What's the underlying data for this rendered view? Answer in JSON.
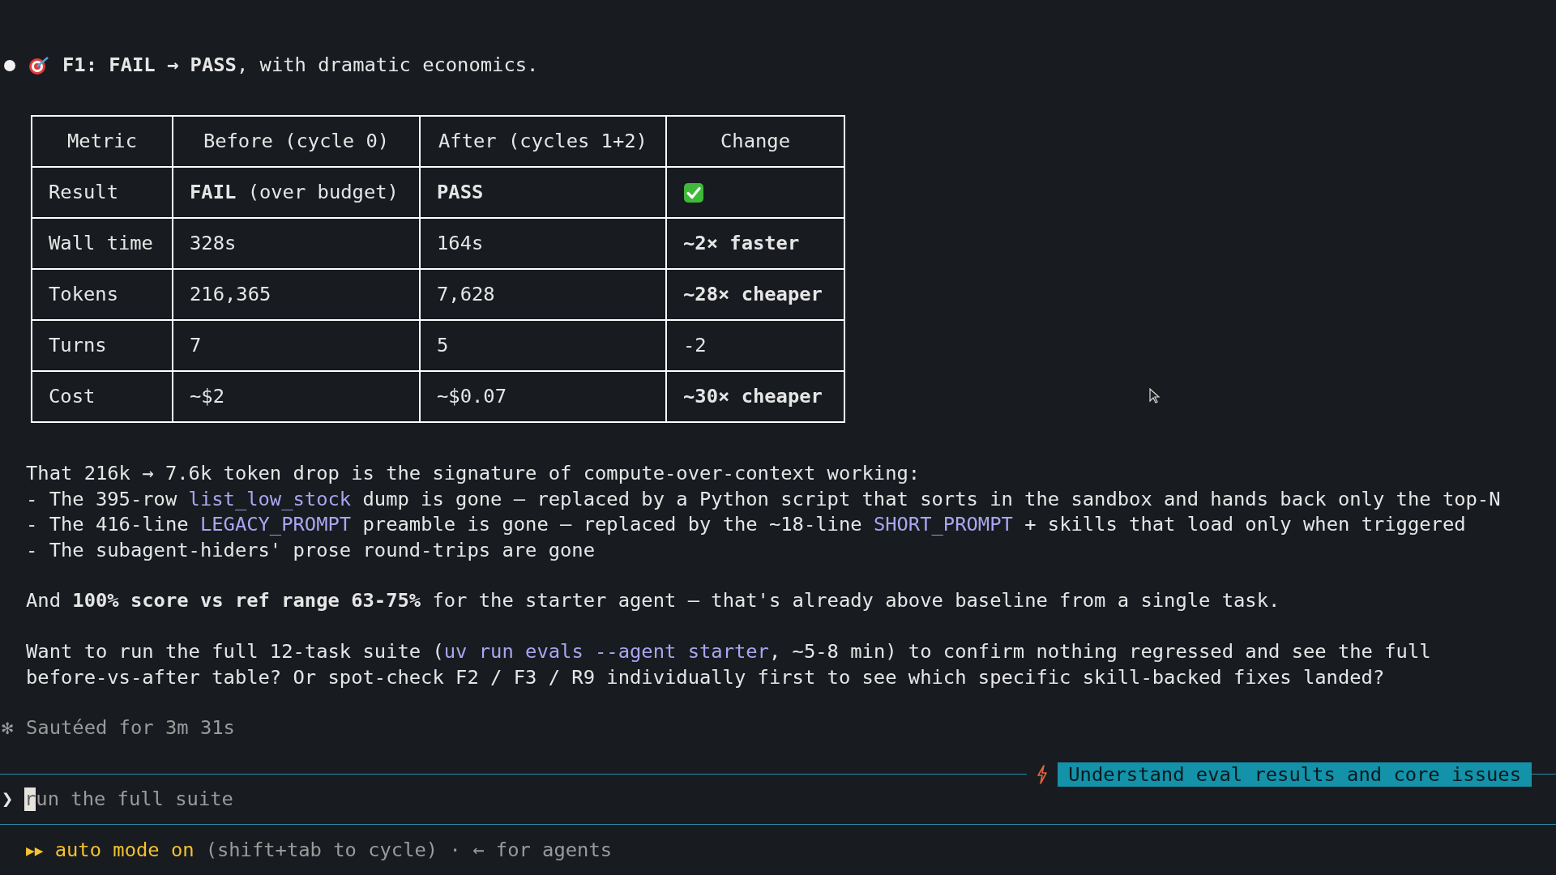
{
  "message": {
    "title": "**F1: FAIL → PASS**, with dramatic economics."
  },
  "table": {
    "columns": [
      "Metric",
      "Before (cycle 0)",
      "After (cycles 1+2)",
      "Change"
    ],
    "rows": [
      [
        {
          "kind": "text",
          "text": "Result",
          "bold": false
        },
        {
          "kind": "text",
          "text": "**FAIL** (over budget)",
          "bold": false
        },
        {
          "kind": "text",
          "text": "PASS",
          "bold": true
        },
        {
          "kind": "check"
        }
      ],
      [
        {
          "kind": "text",
          "text": "Wall time",
          "bold": false
        },
        {
          "kind": "text",
          "text": "328s",
          "bold": false
        },
        {
          "kind": "text",
          "text": "164s",
          "bold": false
        },
        {
          "kind": "text",
          "text": "~2× faster",
          "bold": true
        }
      ],
      [
        {
          "kind": "text",
          "text": "Tokens",
          "bold": false
        },
        {
          "kind": "text",
          "text": "216,365",
          "bold": false
        },
        {
          "kind": "text",
          "text": "7,628",
          "bold": false
        },
        {
          "kind": "text",
          "text": "~28× cheaper",
          "bold": true
        }
      ],
      [
        {
          "kind": "text",
          "text": "Turns",
          "bold": false
        },
        {
          "kind": "text",
          "text": "7",
          "bold": false
        },
        {
          "kind": "text",
          "text": "5",
          "bold": false
        },
        {
          "kind": "text",
          "text": "-2",
          "bold": false
        }
      ],
      [
        {
          "kind": "text",
          "text": "Cost",
          "bold": false
        },
        {
          "kind": "text",
          "text": "~$2",
          "bold": false
        },
        {
          "kind": "text",
          "text": "~$0.07",
          "bold": false
        },
        {
          "kind": "text",
          "text": "~30× cheaper",
          "bold": true
        }
      ]
    ]
  },
  "paragraphs": [
    [
      [
        {
          "kind": "plain",
          "text": "That 216k → 7.6k token drop is the signature of compute-over-context working:"
        }
      ],
      [
        {
          "kind": "plain",
          "text": "- The 395-row "
        },
        {
          "kind": "code",
          "text": "list_low_stock"
        },
        {
          "kind": "plain",
          "text": " dump is gone — replaced by a Python script that sorts in the sandbox and hands back only the top-N"
        }
      ],
      [
        {
          "kind": "plain",
          "text": "- The 416-line "
        },
        {
          "kind": "code",
          "text": "LEGACY_PROMPT"
        },
        {
          "kind": "plain",
          "text": " preamble is gone — replaced by the ~18-line "
        },
        {
          "kind": "code",
          "text": "SHORT_PROMPT"
        },
        {
          "kind": "plain",
          "text": " + skills that load only when triggered"
        }
      ],
      [
        {
          "kind": "plain",
          "text": "- The subagent-hiders' prose round-trips are gone"
        }
      ]
    ],
    [
      [
        {
          "kind": "plain",
          "text": "And **100% score vs ref range 63-75%** for the starter agent — that's already above baseline from a single task."
        }
      ]
    ],
    [
      [
        {
          "kind": "plain",
          "text": "Want to run the full 12-task suite ("
        },
        {
          "kind": "code",
          "text": "uv run evals --agent starter"
        },
        {
          "kind": "plain",
          "text": ", ~5-8 min) to confirm nothing regressed and see the full"
        }
      ],
      [
        {
          "kind": "plain",
          "text": "before-vs-after table? Or spot-check F2 / F3 / R9 individually first to see which specific skill-backed fixes landed?"
        }
      ]
    ]
  ],
  "status": {
    "symbol": "✻",
    "text": "Sautéed for 3m 31s"
  },
  "task_badge": "Understand eval results and core issues",
  "prompt": {
    "symbol": "❯",
    "placeholder": "run the full suite"
  },
  "footer": {
    "mode_symbol": "▶▶",
    "mode": "auto mode on",
    "hint": "(shift+tab to cycle) · ← for agents"
  }
}
